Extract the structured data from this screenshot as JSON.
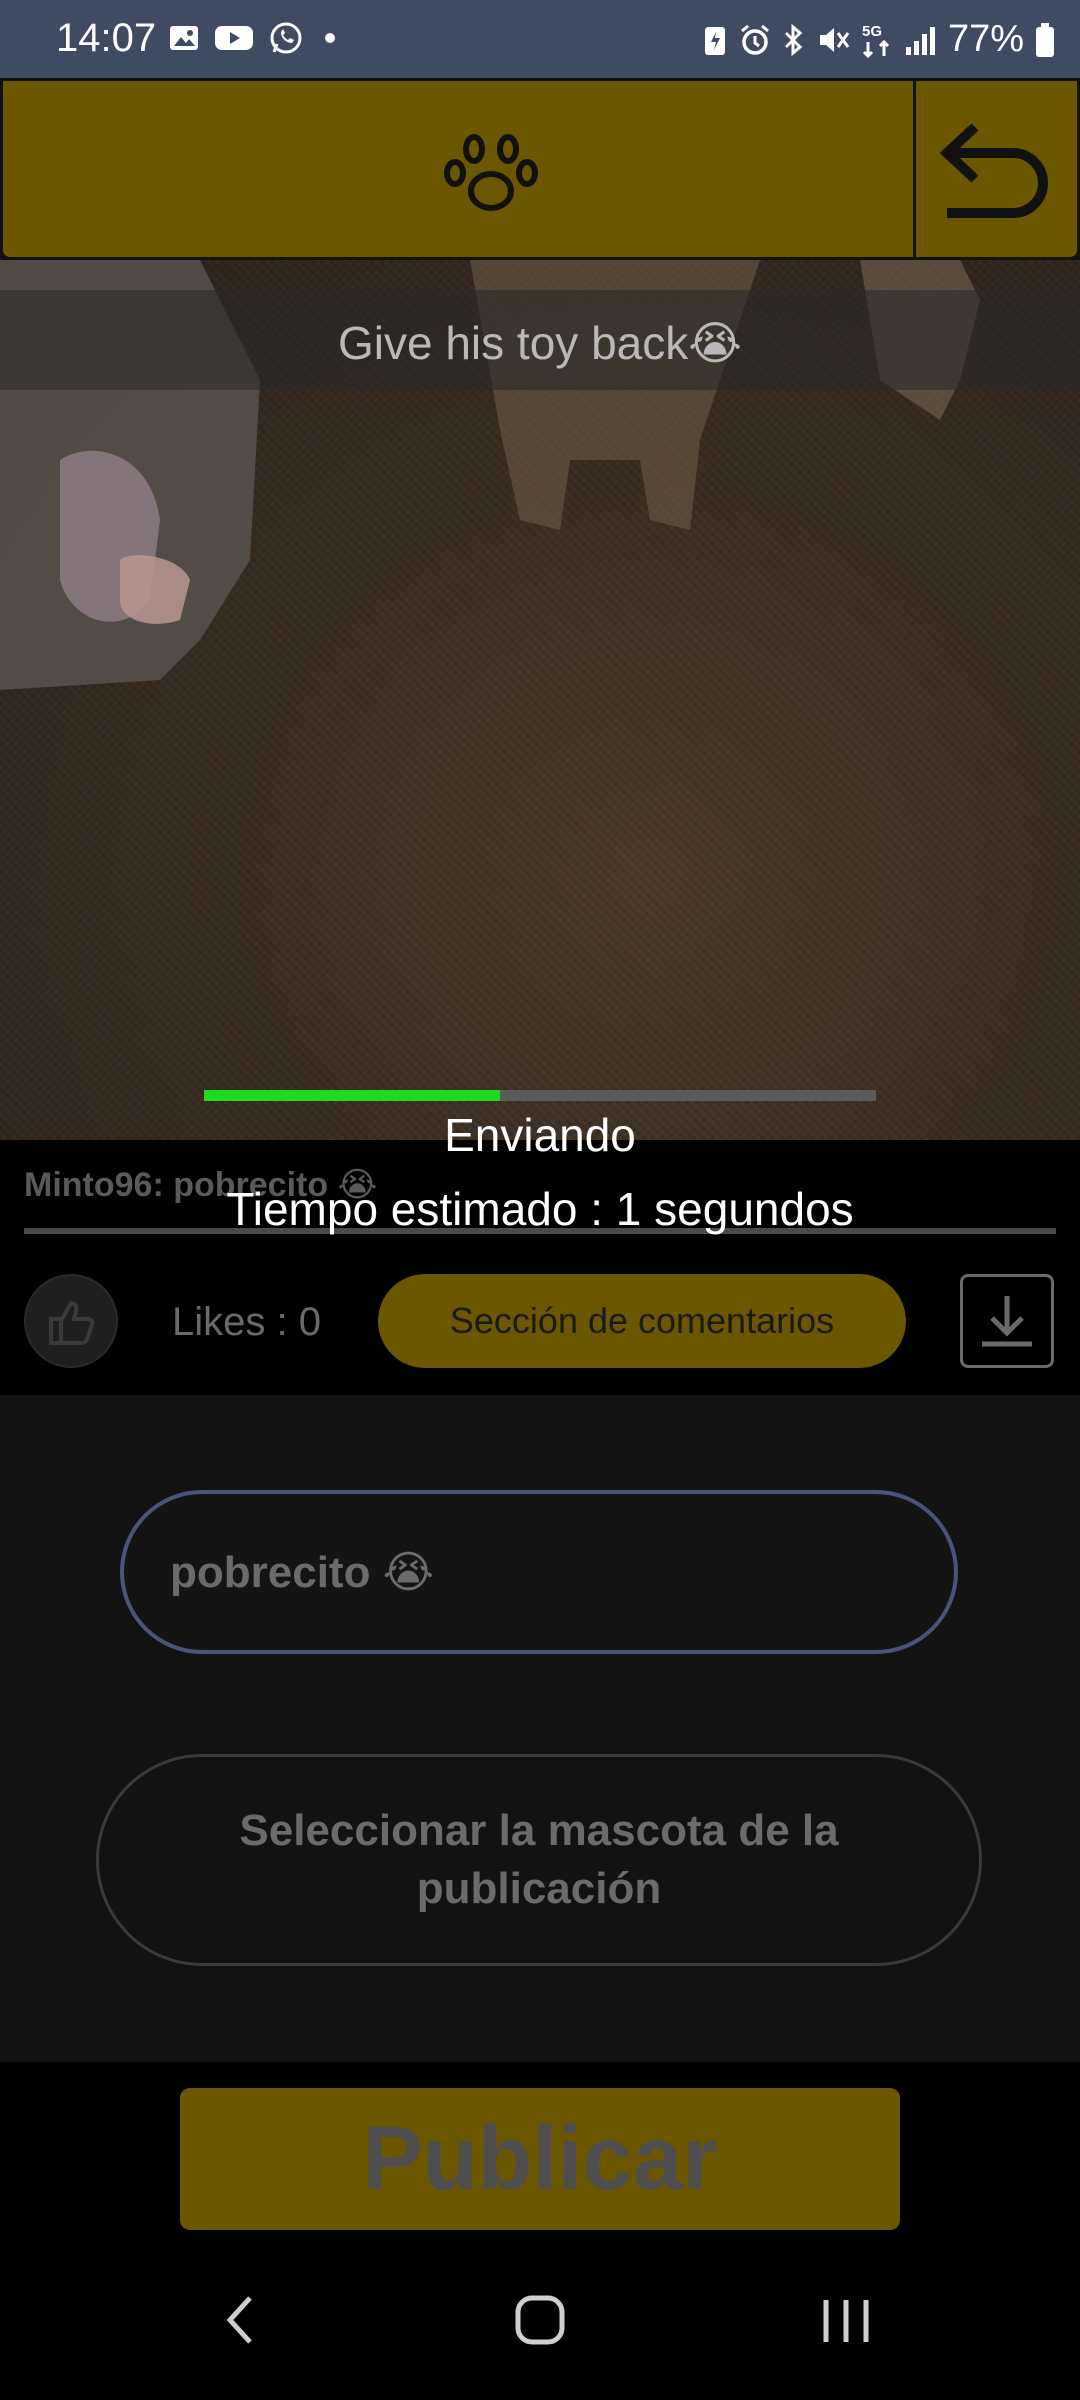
{
  "status_bar": {
    "time": "14:07",
    "battery": "77%",
    "network": "5G",
    "left_icons": [
      "gallery-icon",
      "youtube-icon",
      "whatsapp-icon",
      "dot-icon"
    ],
    "right_icons": [
      "battery-saver-icon",
      "alarm-icon",
      "bluetooth-icon",
      "mute-icon",
      "5g-icon",
      "signal-icon",
      "battery-icon"
    ]
  },
  "header": {
    "center_icon": "paw-icon",
    "back_icon": "back-arrow-icon"
  },
  "video": {
    "caption": "Give his toy back😭"
  },
  "upload": {
    "progress": 0.44,
    "status": "Enviando",
    "estimate": "Tiempo estimado : 1 segundos"
  },
  "post": {
    "comment": "Minto96: pobrecito 😭",
    "likes": "Likes : 0",
    "comments_button": "Sección de comentarios"
  },
  "form": {
    "description_value": "pobrecito 😭",
    "select_pet_label": "Seleccionar la mascota de la publicación",
    "publish_label": "Publicar"
  },
  "colors": {
    "accent": "#6b5700",
    "progress": "#1ddc1d",
    "background": "#121212",
    "status_bar": "#3f4a63"
  }
}
